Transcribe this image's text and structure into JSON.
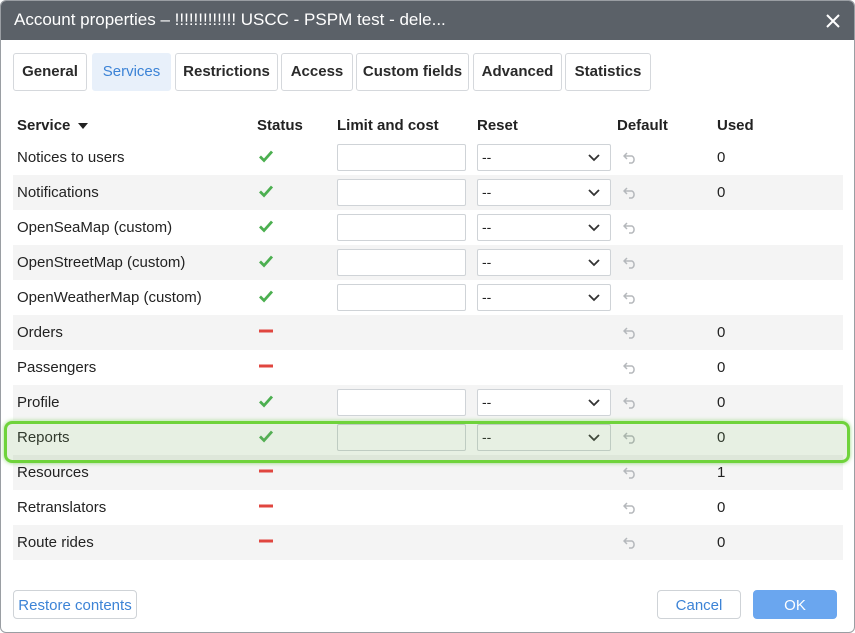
{
  "dialog": {
    "title": "Account properties – !!!!!!!!!!!!! USCC - PSPM test - dele...",
    "close_icon": "close-icon"
  },
  "tabs": [
    {
      "label": "General",
      "active": false
    },
    {
      "label": "Services",
      "active": true
    },
    {
      "label": "Restrictions",
      "active": false
    },
    {
      "label": "Access",
      "active": false
    },
    {
      "label": "Custom fields",
      "active": false
    },
    {
      "label": "Advanced",
      "active": false
    },
    {
      "label": "Statistics",
      "active": false
    }
  ],
  "table": {
    "headers": {
      "service": "Service",
      "status": "Status",
      "limit": "Limit and cost",
      "reset": "Reset",
      "default": "Default",
      "used": "Used"
    },
    "sort_icon": "caret-down-icon",
    "rows": [
      {
        "name": "Notices to users",
        "status": "enabled",
        "has_inputs": true,
        "reset": "--",
        "used": "0"
      },
      {
        "name": "Notifications",
        "status": "enabled",
        "has_inputs": true,
        "reset": "--",
        "used": "0"
      },
      {
        "name": "OpenSeaMap (custom)",
        "status": "enabled",
        "has_inputs": true,
        "reset": "--",
        "used": ""
      },
      {
        "name": "OpenStreetMap (custom)",
        "status": "enabled",
        "has_inputs": true,
        "reset": "--",
        "used": ""
      },
      {
        "name": "OpenWeatherMap (custom)",
        "status": "enabled",
        "has_inputs": true,
        "reset": "--",
        "used": ""
      },
      {
        "name": "Orders",
        "status": "disabled",
        "has_inputs": false,
        "reset": "",
        "used": "0"
      },
      {
        "name": "Passengers",
        "status": "disabled",
        "has_inputs": false,
        "reset": "",
        "used": "0"
      },
      {
        "name": "Profile",
        "status": "enabled",
        "has_inputs": true,
        "reset": "--",
        "used": "0"
      },
      {
        "name": "Reports",
        "status": "enabled",
        "has_inputs": true,
        "reset": "--",
        "used": "0",
        "highlighted": true
      },
      {
        "name": "Resources",
        "status": "disabled",
        "has_inputs": false,
        "reset": "",
        "used": "1"
      },
      {
        "name": "Retranslators",
        "status": "disabled",
        "has_inputs": false,
        "reset": "",
        "used": "0"
      },
      {
        "name": "Route rides",
        "status": "disabled",
        "has_inputs": false,
        "reset": "",
        "used": "0"
      }
    ]
  },
  "footer": {
    "restore_label": "Restore contents",
    "cancel_label": "Cancel",
    "ok_label": "OK"
  },
  "colors": {
    "titlebar": "#5b6168",
    "accent": "#3c83d6",
    "ok_button": "#6aa6ef",
    "enabled_check": "#4caf50",
    "disabled_dash": "#e0463f",
    "highlight_border": "#6fd33b"
  }
}
